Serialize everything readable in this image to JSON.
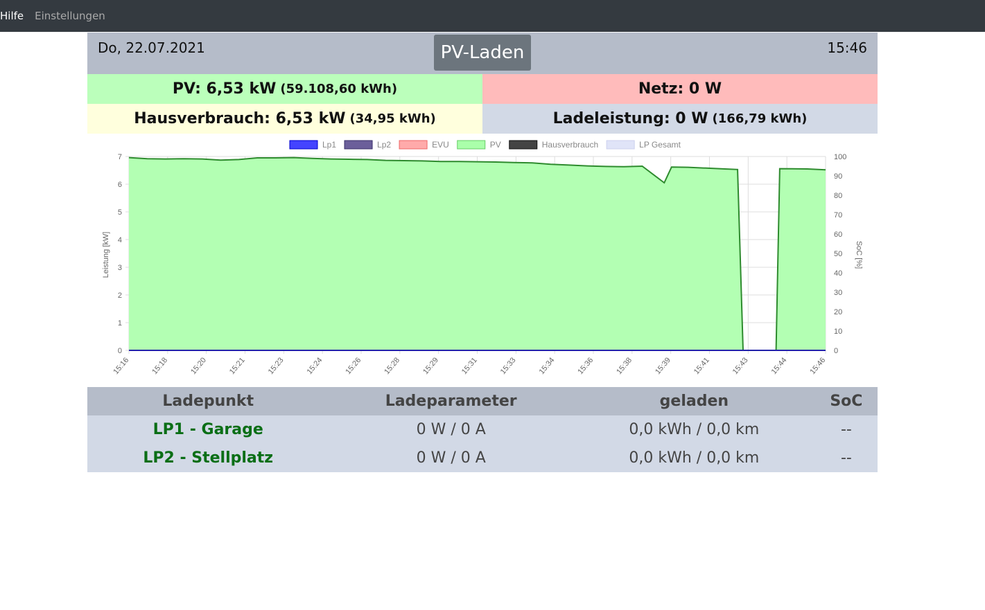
{
  "nav": {
    "items": [
      "Hilfe",
      "Einstellungen"
    ]
  },
  "header": {
    "date": "Do, 22.07.2021",
    "mode": "PV-Laden",
    "time": "15:46"
  },
  "summary": {
    "pv_label": "PV: 6,53 kW",
    "pv_energy": "(59.108,60 kWh)",
    "netz_label": "Netz: 0 W",
    "haus_label": "Hausverbrauch: 6,53 kW",
    "haus_energy": "(34,95 kWh)",
    "lade_label": "Ladeleistung: 0 W",
    "lade_energy": "(166,79 kWh)"
  },
  "colors": {
    "pv_bg": "#bbffbb",
    "netz_bg": "#ffbbbb",
    "haus_bg": "#ffffdd",
    "lade_bg": "#d2d9e6"
  },
  "chart_data": {
    "type": "area",
    "legend": [
      {
        "name": "Lp1",
        "color": "#4444ff",
        "border": "#0000cc"
      },
      {
        "name": "Lp2",
        "color": "#6b5f9a",
        "border": "#3a2f6a"
      },
      {
        "name": "EVU",
        "color": "#ffaaaa",
        "border": "#ee6666"
      },
      {
        "name": "PV",
        "color": "#aaffaa",
        "border": "#66cc66"
      },
      {
        "name": "Hausverbrauch",
        "color": "#444444",
        "border": "#111111"
      },
      {
        "name": "LP Gesamt",
        "color": "#e0e4f8",
        "border": "#ccd0ee"
      }
    ],
    "ylabel": "Leistung [kW]",
    "y2label": "SoC [%]",
    "ylim": [
      0,
      7
    ],
    "y2lim": [
      0,
      100
    ],
    "yticks": [
      "0",
      "1",
      "2",
      "3",
      "4",
      "5",
      "6",
      "7"
    ],
    "y2ticks": [
      "0",
      "10",
      "20",
      "30",
      "40",
      "50",
      "60",
      "70",
      "80",
      "90",
      "100"
    ],
    "xticks": [
      "15:16",
      "15:18",
      "15:20",
      "15:21",
      "15:23",
      "15:24",
      "15:26",
      "15:28",
      "15:29",
      "15:31",
      "15:33",
      "15:34",
      "15:36",
      "15:38",
      "15:39",
      "15:41",
      "15:43",
      "15:44",
      "15:46"
    ],
    "xrange_min": [
      0,
      30
    ],
    "series": [
      {
        "name": "PV",
        "points": [
          [
            0,
            6.96
          ],
          [
            1,
            6.92
          ],
          [
            2,
            6.91
          ],
          [
            3,
            6.92
          ],
          [
            4,
            6.91
          ],
          [
            5,
            6.87
          ],
          [
            6,
            6.89
          ],
          [
            7,
            6.95
          ],
          [
            8,
            6.95
          ],
          [
            9,
            6.96
          ],
          [
            10,
            6.93
          ],
          [
            11,
            6.91
          ],
          [
            12,
            6.9
          ],
          [
            13,
            6.89
          ],
          [
            14,
            6.86
          ],
          [
            15,
            6.85
          ],
          [
            16,
            6.84
          ],
          [
            17,
            6.82
          ],
          [
            18,
            6.82
          ],
          [
            19,
            6.81
          ],
          [
            20,
            6.8
          ],
          [
            21,
            6.78
          ],
          [
            22,
            6.77
          ],
          [
            23,
            6.72
          ],
          [
            24,
            6.69
          ],
          [
            25,
            6.66
          ],
          [
            26,
            6.64
          ],
          [
            27,
            6.63
          ],
          [
            28,
            6.65
          ],
          [
            29.2,
            6.05
          ],
          [
            29.6,
            6.62
          ],
          [
            30.5,
            6.61
          ],
          [
            31.5,
            6.58
          ],
          [
            32.5,
            6.55
          ],
          [
            33.2,
            6.53
          ],
          [
            33.5,
            0
          ],
          [
            35.3,
            0
          ],
          [
            35.5,
            6.56
          ],
          [
            37,
            6.55
          ],
          [
            38,
            6.52
          ]
        ]
      },
      {
        "name": "Lp1",
        "points": [
          [
            0,
            0
          ],
          [
            38,
            0
          ]
        ]
      }
    ]
  },
  "table": {
    "headers": [
      "Ladepunkt",
      "Ladeparameter",
      "geladen",
      "SoC"
    ],
    "rows": [
      [
        "LP1 - Garage",
        "0 W / 0 A",
        "0,0 kWh / 0,0 km",
        "--"
      ],
      [
        "LP2 - Stellplatz",
        "0 W / 0 A",
        "0,0 kWh / 0,0 km",
        "--"
      ]
    ]
  }
}
